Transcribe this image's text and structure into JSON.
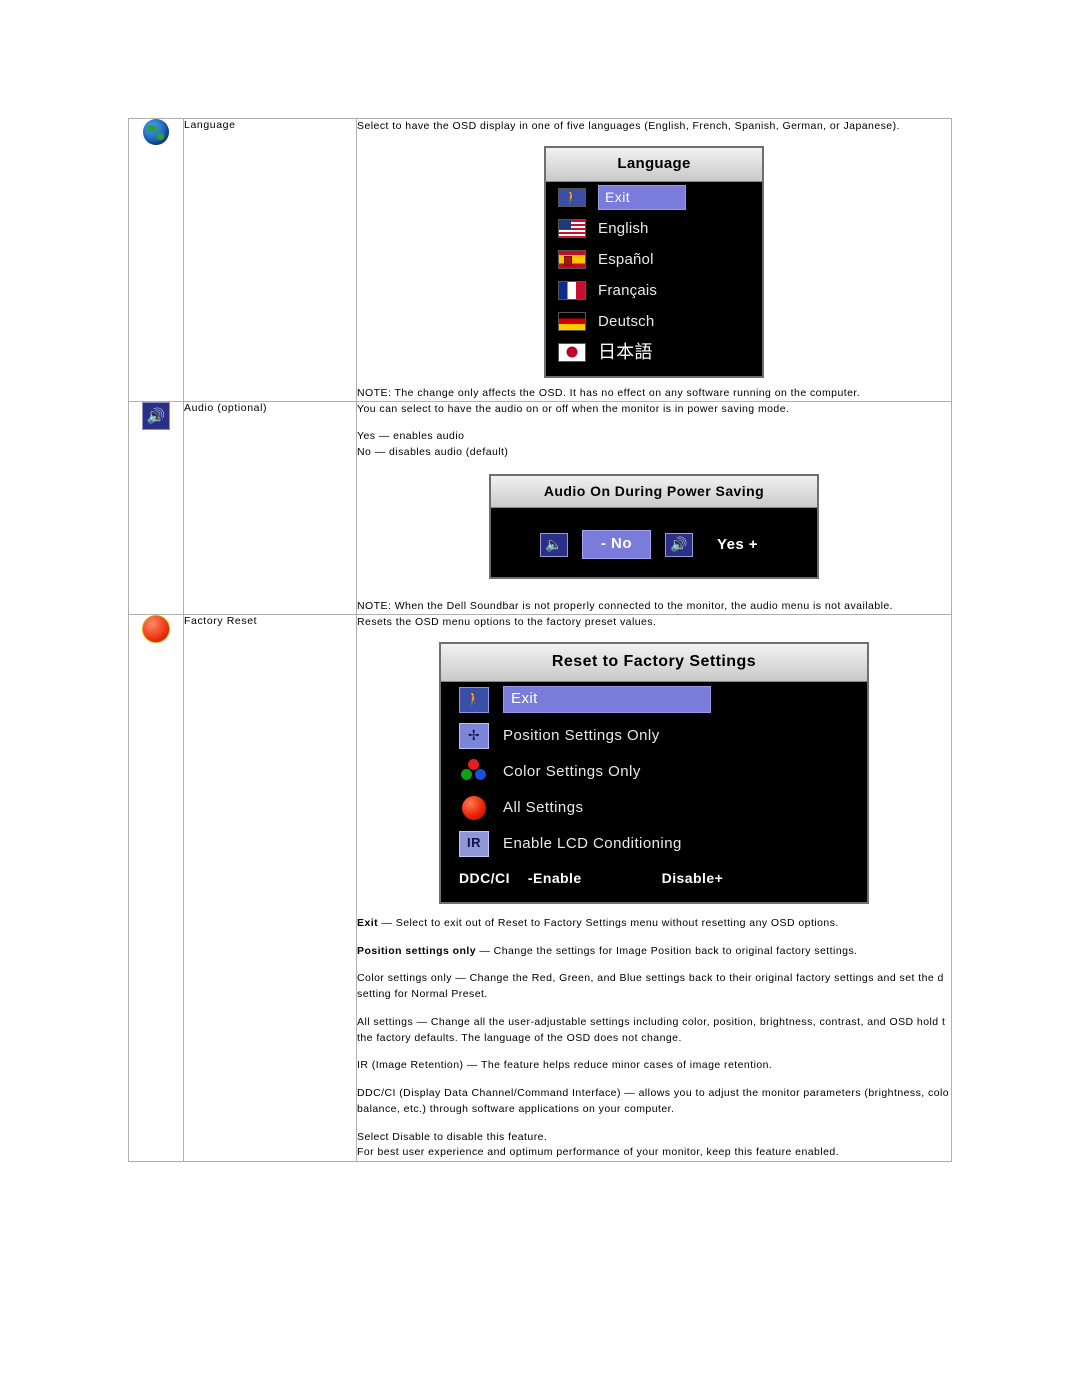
{
  "rows": [
    {
      "id": "language",
      "icon": "globe-icon",
      "name": "Language",
      "description": "Select to have the OSD display in one of five languages (English, French, Spanish, German, or Japanese).",
      "note": "NOTE: The change only affects the OSD. It has no effect on any software running on the computer.",
      "osd": {
        "title": "Language",
        "items": [
          {
            "label": "Exit",
            "flag": "exit",
            "selected": true
          },
          {
            "label": "English",
            "flag": "us",
            "selected": false
          },
          {
            "label": "Español",
            "flag": "es",
            "selected": false
          },
          {
            "label": "Français",
            "flag": "fr",
            "selected": false
          },
          {
            "label": "Deutsch",
            "flag": "de",
            "selected": false
          },
          {
            "label": "日本語",
            "flag": "jp",
            "selected": false
          }
        ]
      }
    },
    {
      "id": "audio",
      "icon": "speaker-icon",
      "name": "Audio (optional)",
      "description": "You can select to have the audio on or off when the monitor is in power saving mode.",
      "line2": "Yes — enables audio",
      "line3": "No — disables audio (default)",
      "note": "NOTE: When the Dell Soundbar is not properly connected to the monitor, the audio menu is not available.",
      "osd": {
        "title": "Audio On During Power Saving",
        "no_label": "- No",
        "yes_label": "Yes +"
      }
    },
    {
      "id": "factory-reset",
      "icon": "reset-circle-icon",
      "name": "Factory Reset",
      "description": "Resets the OSD menu options to  the factory preset values.",
      "osd": {
        "title": "Reset to Factory Settings",
        "items": [
          {
            "label": "Exit",
            "icon": "exit-person-icon",
            "selected": true
          },
          {
            "label": "Position Settings Only",
            "icon": "position-arrows-icon",
            "selected": false
          },
          {
            "label": "Color Settings Only",
            "icon": "rgb-dots-icon",
            "selected": false
          },
          {
            "label": "All Settings",
            "icon": "red-circle-icon",
            "selected": false
          },
          {
            "label": "Enable LCD Conditioning",
            "icon": "ir-icon",
            "selected": false
          }
        ],
        "ddc_label": "DDC/CI",
        "ddc_enable": "-Enable",
        "ddc_disable": "Disable+"
      },
      "paragraphs": [
        {
          "bold": "Exit",
          "text": " — Select to exit out of Reset to Factory Settings menu without resetting any OSD options."
        },
        {
          "bold": "Position settings only",
          "text": " — Change the settings for Image Position back to original factory settings."
        },
        {
          "bold": "",
          "text": "Color settings only — Change the Red, Green, and Blue settings back to their original factory settings and set  the d"
        },
        {
          "bold": "",
          "text": "setting for Normal Preset."
        },
        {
          "bold": "",
          "text": "All settings —  Change all the user-adjustable settings including color, position, brightness, contrast, and OSD hold t"
        },
        {
          "bold": "",
          "text": "the factory defaults. The language of the OSD does not change."
        },
        {
          "bold": "",
          "text": "IR (Image Retention) — The feature helps reduce minor cases of image retention."
        },
        {
          "bold": "",
          "text": "DDC/CI (Display Data Channel/Command Interface) — allows you to adjust the monitor parameters (brightness, colo"
        },
        {
          "bold": "",
          "text": "balance, etc.)  through software applications on your computer."
        },
        {
          "bold": "",
          "text": "Select Disable to disable this feature."
        },
        {
          "bold": "",
          "text": "For best user experience and optimum performance of your monitor, keep this feature enabled."
        }
      ]
    }
  ]
}
